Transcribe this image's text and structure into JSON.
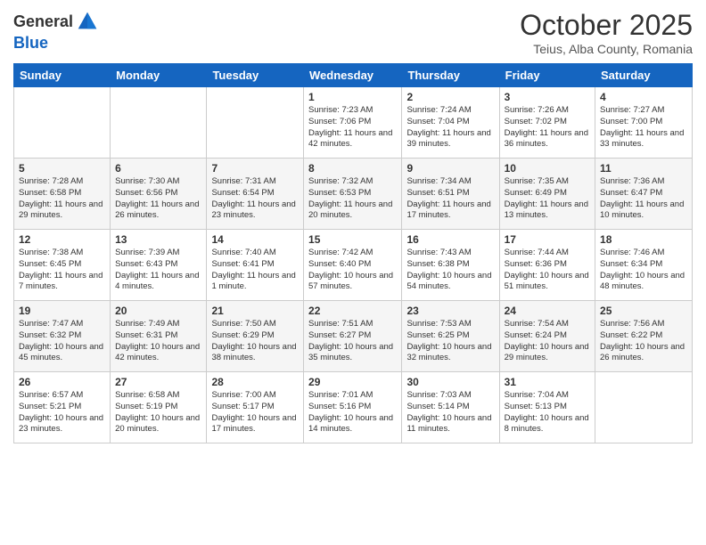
{
  "logo": {
    "general": "General",
    "blue": "Blue"
  },
  "header": {
    "title": "October 2025",
    "subtitle": "Teius, Alba County, Romania"
  },
  "weekdays": [
    "Sunday",
    "Monday",
    "Tuesday",
    "Wednesday",
    "Thursday",
    "Friday",
    "Saturday"
  ],
  "rows": [
    [
      {
        "day": "",
        "info": ""
      },
      {
        "day": "",
        "info": ""
      },
      {
        "day": "",
        "info": ""
      },
      {
        "day": "1",
        "info": "Sunrise: 7:23 AM\nSunset: 7:06 PM\nDaylight: 11 hours and 42 minutes."
      },
      {
        "day": "2",
        "info": "Sunrise: 7:24 AM\nSunset: 7:04 PM\nDaylight: 11 hours and 39 minutes."
      },
      {
        "day": "3",
        "info": "Sunrise: 7:26 AM\nSunset: 7:02 PM\nDaylight: 11 hours and 36 minutes."
      },
      {
        "day": "4",
        "info": "Sunrise: 7:27 AM\nSunset: 7:00 PM\nDaylight: 11 hours and 33 minutes."
      }
    ],
    [
      {
        "day": "5",
        "info": "Sunrise: 7:28 AM\nSunset: 6:58 PM\nDaylight: 11 hours and 29 minutes."
      },
      {
        "day": "6",
        "info": "Sunrise: 7:30 AM\nSunset: 6:56 PM\nDaylight: 11 hours and 26 minutes."
      },
      {
        "day": "7",
        "info": "Sunrise: 7:31 AM\nSunset: 6:54 PM\nDaylight: 11 hours and 23 minutes."
      },
      {
        "day": "8",
        "info": "Sunrise: 7:32 AM\nSunset: 6:53 PM\nDaylight: 11 hours and 20 minutes."
      },
      {
        "day": "9",
        "info": "Sunrise: 7:34 AM\nSunset: 6:51 PM\nDaylight: 11 hours and 17 minutes."
      },
      {
        "day": "10",
        "info": "Sunrise: 7:35 AM\nSunset: 6:49 PM\nDaylight: 11 hours and 13 minutes."
      },
      {
        "day": "11",
        "info": "Sunrise: 7:36 AM\nSunset: 6:47 PM\nDaylight: 11 hours and 10 minutes."
      }
    ],
    [
      {
        "day": "12",
        "info": "Sunrise: 7:38 AM\nSunset: 6:45 PM\nDaylight: 11 hours and 7 minutes."
      },
      {
        "day": "13",
        "info": "Sunrise: 7:39 AM\nSunset: 6:43 PM\nDaylight: 11 hours and 4 minutes."
      },
      {
        "day": "14",
        "info": "Sunrise: 7:40 AM\nSunset: 6:41 PM\nDaylight: 11 hours and 1 minute."
      },
      {
        "day": "15",
        "info": "Sunrise: 7:42 AM\nSunset: 6:40 PM\nDaylight: 10 hours and 57 minutes."
      },
      {
        "day": "16",
        "info": "Sunrise: 7:43 AM\nSunset: 6:38 PM\nDaylight: 10 hours and 54 minutes."
      },
      {
        "day": "17",
        "info": "Sunrise: 7:44 AM\nSunset: 6:36 PM\nDaylight: 10 hours and 51 minutes."
      },
      {
        "day": "18",
        "info": "Sunrise: 7:46 AM\nSunset: 6:34 PM\nDaylight: 10 hours and 48 minutes."
      }
    ],
    [
      {
        "day": "19",
        "info": "Sunrise: 7:47 AM\nSunset: 6:32 PM\nDaylight: 10 hours and 45 minutes."
      },
      {
        "day": "20",
        "info": "Sunrise: 7:49 AM\nSunset: 6:31 PM\nDaylight: 10 hours and 42 minutes."
      },
      {
        "day": "21",
        "info": "Sunrise: 7:50 AM\nSunset: 6:29 PM\nDaylight: 10 hours and 38 minutes."
      },
      {
        "day": "22",
        "info": "Sunrise: 7:51 AM\nSunset: 6:27 PM\nDaylight: 10 hours and 35 minutes."
      },
      {
        "day": "23",
        "info": "Sunrise: 7:53 AM\nSunset: 6:25 PM\nDaylight: 10 hours and 32 minutes."
      },
      {
        "day": "24",
        "info": "Sunrise: 7:54 AM\nSunset: 6:24 PM\nDaylight: 10 hours and 29 minutes."
      },
      {
        "day": "25",
        "info": "Sunrise: 7:56 AM\nSunset: 6:22 PM\nDaylight: 10 hours and 26 minutes."
      }
    ],
    [
      {
        "day": "26",
        "info": "Sunrise: 6:57 AM\nSunset: 5:21 PM\nDaylight: 10 hours and 23 minutes."
      },
      {
        "day": "27",
        "info": "Sunrise: 6:58 AM\nSunset: 5:19 PM\nDaylight: 10 hours and 20 minutes."
      },
      {
        "day": "28",
        "info": "Sunrise: 7:00 AM\nSunset: 5:17 PM\nDaylight: 10 hours and 17 minutes."
      },
      {
        "day": "29",
        "info": "Sunrise: 7:01 AM\nSunset: 5:16 PM\nDaylight: 10 hours and 14 minutes."
      },
      {
        "day": "30",
        "info": "Sunrise: 7:03 AM\nSunset: 5:14 PM\nDaylight: 10 hours and 11 minutes."
      },
      {
        "day": "31",
        "info": "Sunrise: 7:04 AM\nSunset: 5:13 PM\nDaylight: 10 hours and 8 minutes."
      },
      {
        "day": "",
        "info": ""
      }
    ]
  ]
}
